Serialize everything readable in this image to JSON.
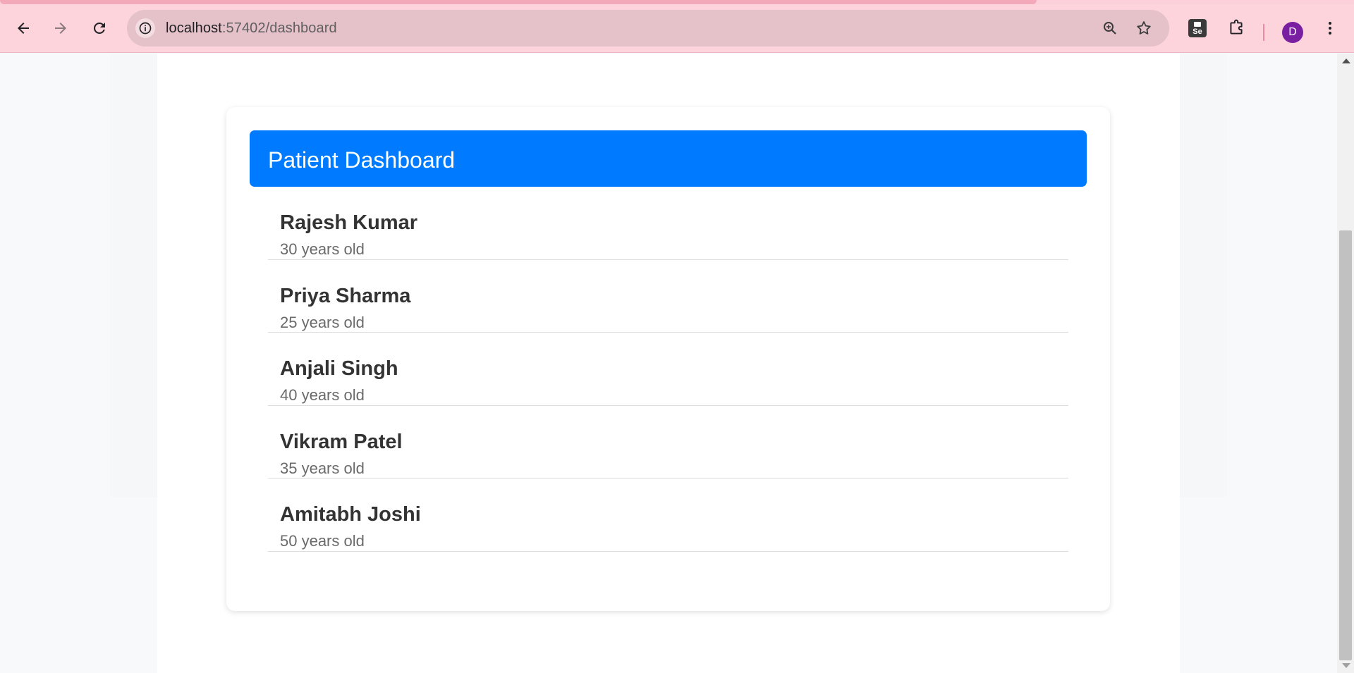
{
  "browser": {
    "url_host": "localhost",
    "url_path": ":57402/dashboard",
    "avatar_letter": "D",
    "icons": {
      "back": "back-arrow-icon",
      "forward": "forward-arrow-icon",
      "reload": "reload-icon",
      "site_info": "info-icon",
      "zoom": "zoom-icon",
      "bookmark": "star-icon",
      "extension_selenium": "selenium-icon",
      "extensions": "puzzle-icon",
      "menu": "kebab-menu-icon"
    },
    "colors": {
      "toolbar": "#fdd3dc",
      "omnibox": "#e5c1c9",
      "avatar": "#7b1fa2"
    }
  },
  "dashboard": {
    "title": "Patient Dashboard",
    "header_color": "#007bff",
    "patients": [
      {
        "name": "Rajesh Kumar",
        "age": "30 years old"
      },
      {
        "name": "Priya Sharma",
        "age": "25 years old"
      },
      {
        "name": "Anjali Singh",
        "age": "40 years old"
      },
      {
        "name": "Vikram Patel",
        "age": "35 years old"
      },
      {
        "name": "Amitabh Joshi",
        "age": "50 years old"
      }
    ]
  }
}
